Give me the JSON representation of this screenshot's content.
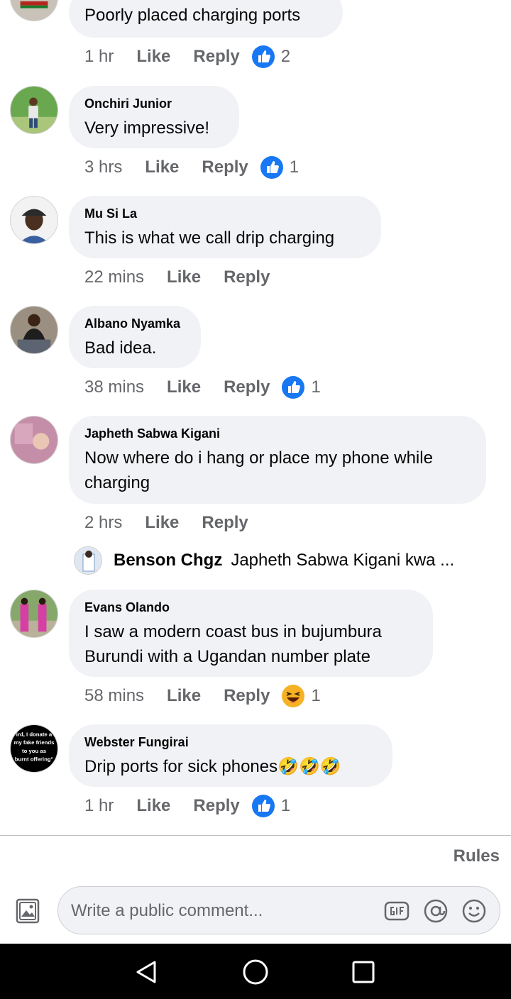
{
  "comments": [
    {
      "author": "",
      "text": "Poorly placed charging ports",
      "time": "1 hr",
      "like": "Like",
      "reply": "Reply",
      "reaction": "like",
      "count": "2"
    },
    {
      "author": "Onchiri Junior",
      "text": "Very impressive!",
      "time": "3 hrs",
      "like": "Like",
      "reply": "Reply",
      "reaction": "like",
      "count": "1"
    },
    {
      "author": "Mu Si La",
      "text": "This is what we call drip charging",
      "time": "22 mins",
      "like": "Like",
      "reply": "Reply",
      "reaction": "",
      "count": ""
    },
    {
      "author": "Albano Nyamka",
      "text": "Bad idea.",
      "time": "38 mins",
      "like": "Like",
      "reply": "Reply",
      "reaction": "like",
      "count": "1"
    },
    {
      "author": "Japheth Sabwa Kigani",
      "text": "Now where do i hang or place my phone while charging",
      "time": "2 hrs",
      "like": "Like",
      "reply": "Reply",
      "reaction": "",
      "count": ""
    },
    {
      "author": "Evans Olando",
      "text": "I saw a modern coast bus in bujumbura Burundi with a Ugandan number plate",
      "time": "58 mins",
      "like": "Like",
      "reply": "Reply",
      "reaction": "haha",
      "count": "1"
    },
    {
      "author": "Webster Fungirai",
      "text": "Drip ports for sick phones🤣🤣🤣",
      "time": "1 hr",
      "like": "Like",
      "reply": "Reply",
      "reaction": "like",
      "count": "1"
    }
  ],
  "reply_preview": {
    "author": "Benson Chgz",
    "text": "Japheth Sabwa Kigani kwa ..."
  },
  "avatar_text_webster": [
    "ird, I donate a",
    "my fake friends",
    "to you as",
    "burnt offering\""
  ],
  "rules_label": "Rules",
  "composer": {
    "placeholder": "Write a public comment..."
  },
  "icons": {
    "photo": "photo-icon",
    "gif": "gif-icon",
    "mention": "at-icon",
    "emoji": "emoji-icon",
    "like": "like-reaction-icon",
    "haha": "haha-reaction-icon"
  },
  "colors": {
    "like_blue": "#1877f2",
    "bubble": "#f0f2f5",
    "meta": "#65676b",
    "haha_yellow": "#f7b125"
  }
}
